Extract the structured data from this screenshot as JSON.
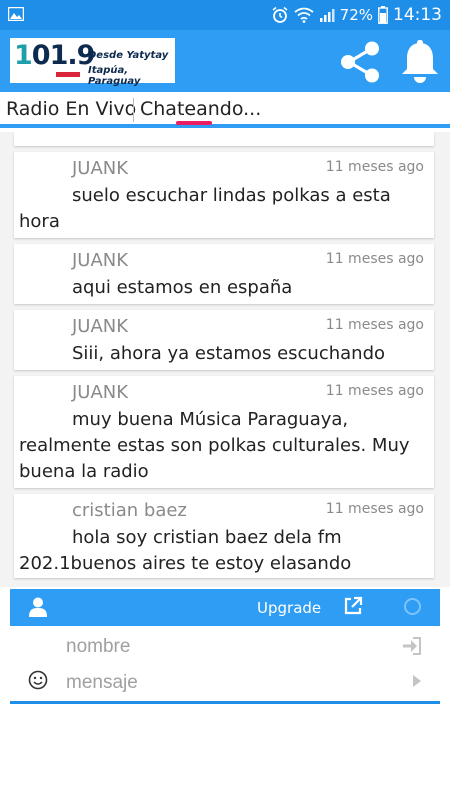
{
  "status_bar": {
    "battery": "72%",
    "time": "14:13"
  },
  "header": {
    "logo_number": "101.9",
    "logo_tagline_1": "Desde Yatytay",
    "logo_tagline_2": "Itapúa, Paraguay"
  },
  "tabs": [
    {
      "label": "Radio En Vivo"
    },
    {
      "label": "Chateando..."
    }
  ],
  "messages": [
    {
      "user": "JUANK",
      "time": "11 meses ago",
      "text": "suelo escuchar lindas polkas a esta hora"
    },
    {
      "user": "JUANK",
      "time": "11 meses ago",
      "text": "aqui estamos en españa"
    },
    {
      "user": "JUANK",
      "time": "11 meses ago",
      "text": "Siii, ahora ya estamos escuchando"
    },
    {
      "user": "JUANK",
      "time": "11 meses ago",
      "text": "muy buena Música Paraguaya, realmente estas son polkas culturales. Muy buena la radio"
    },
    {
      "user": "cristian baez",
      "time": "11 meses ago",
      "text": "hola soy cristian baez dela fm 202.1buenos aires te estoy elasando"
    }
  ],
  "chat_toolbar": {
    "upgrade_label": "Upgrade"
  },
  "form": {
    "name_placeholder": "nombre",
    "name_value": "",
    "message_placeholder": "mensaje",
    "message_value": ""
  },
  "colors": {
    "primary": "#2f9df4",
    "status_bar": "#1e8ee8",
    "tab_indicator": "#e91e63"
  },
  "icons": [
    "image-icon",
    "alarm-icon",
    "wifi-icon",
    "signal-icon",
    "battery-icon",
    "share-icon",
    "bell-icon",
    "user-icon",
    "external-link-icon",
    "circle-icon",
    "login-icon",
    "send-icon",
    "smile-icon"
  ]
}
